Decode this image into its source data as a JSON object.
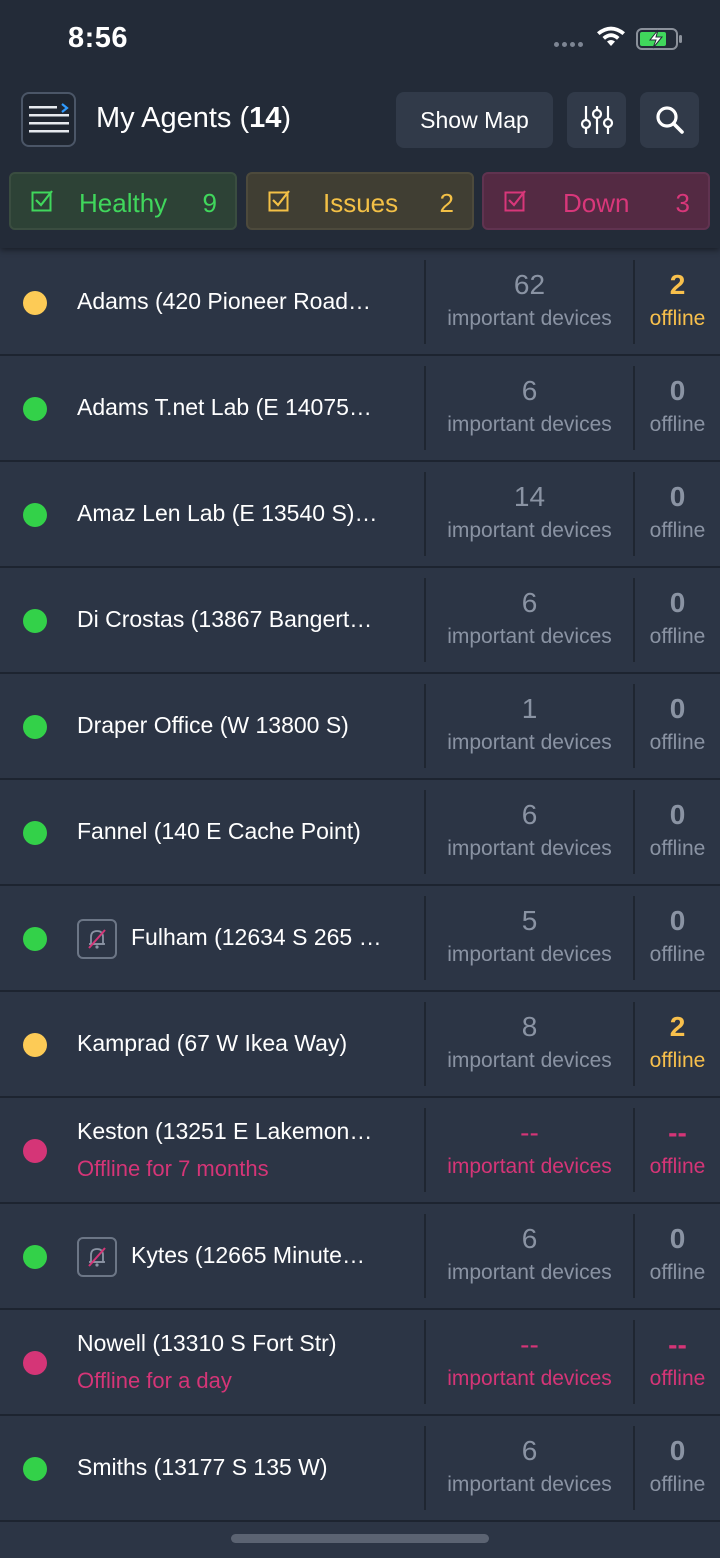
{
  "status_bar": {
    "time": "8:56"
  },
  "header": {
    "title": "My Agents",
    "count": "14",
    "show_map_label": "Show Map"
  },
  "filters": [
    {
      "label": "Healthy",
      "count": "9",
      "color": "#40d75c"
    },
    {
      "label": "Issues",
      "count": "2",
      "color": "#f3c046"
    },
    {
      "label": "Down",
      "count": "3",
      "color": "#d8377a"
    }
  ],
  "agents": [
    {
      "name": "Adams (420 Pioneer Road…",
      "status": "yellow",
      "devices": "62",
      "devices_label": "important devices",
      "offline": "2",
      "offline_label": "offline"
    },
    {
      "name": "Adams T.net Lab (E 14075…",
      "status": "green",
      "devices": "6",
      "devices_label": "important devices",
      "offline": "0",
      "offline_label": "offline"
    },
    {
      "name": "Amaz Len Lab (E 13540 S)…",
      "status": "green",
      "devices": "14",
      "devices_label": "important devices",
      "offline": "0",
      "offline_label": "offline"
    },
    {
      "name": "Di Crostas (13867 Bangert…",
      "status": "green",
      "devices": "6",
      "devices_label": "important devices",
      "offline": "0",
      "offline_label": "offline"
    },
    {
      "name": "Draper Office (W 13800 S)",
      "status": "green",
      "devices": "1",
      "devices_label": "important devices",
      "offline": "0",
      "offline_label": "offline"
    },
    {
      "name": "Fannel (140 E Cache Point)",
      "status": "green",
      "devices": "6",
      "devices_label": "important devices",
      "offline": "0",
      "offline_label": "offline"
    },
    {
      "name": "Fulham (12634 S 265 …",
      "status": "green",
      "muted": true,
      "devices": "5",
      "devices_label": "important devices",
      "offline": "0",
      "offline_label": "offline"
    },
    {
      "name": "Kamprad (67 W Ikea Way)",
      "status": "yellow",
      "devices": "8",
      "devices_label": "important devices",
      "offline": "2",
      "offline_label": "offline"
    },
    {
      "name": "Keston (13251 E Lakemon…",
      "status": "red",
      "sub": "Offline for 7 months",
      "devices": "--",
      "devices_label": "important devices",
      "offline": "--",
      "offline_label": "offline"
    },
    {
      "name": "Kytes (12665 Minute…",
      "status": "green",
      "muted": true,
      "devices": "6",
      "devices_label": "important devices",
      "offline": "0",
      "offline_label": "offline"
    },
    {
      "name": "Nowell (13310 S Fort Str)",
      "status": "red",
      "sub": "Offline for a day",
      "devices": "--",
      "devices_label": "important devices",
      "offline": "--",
      "offline_label": "offline"
    },
    {
      "name": "Smiths (13177 S 135 W)",
      "status": "green",
      "devices": "6",
      "devices_label": "important devices",
      "offline": "0",
      "offline_label": "offline"
    }
  ],
  "colors": {
    "background": "#2c3545",
    "header": "#232b38",
    "healthy": "#33d149",
    "issues": "#fdcb56",
    "down": "#d53577",
    "muted_text": "#8a93a3"
  },
  "icons": [
    "menu-icon",
    "sliders-icon",
    "search-icon",
    "checkbox-icon",
    "bell-slash-icon",
    "wifi-icon",
    "battery-charging-icon"
  ]
}
